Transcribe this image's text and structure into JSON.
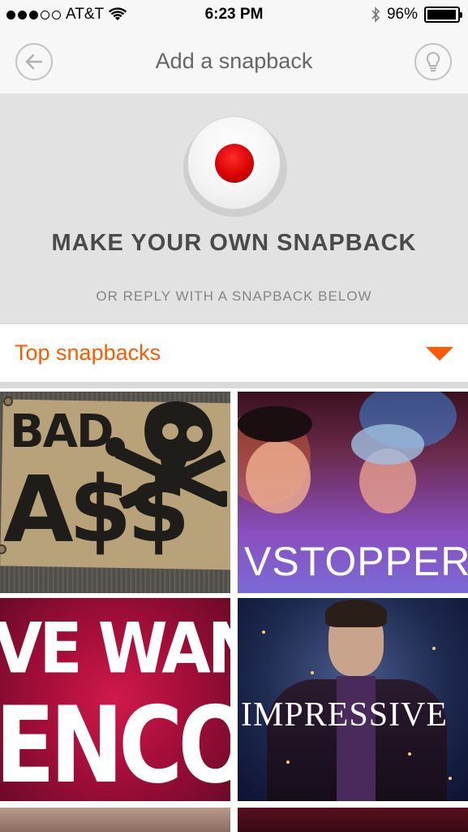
{
  "status_bar": {
    "carrier": "AT&T",
    "time": "6:23 PM",
    "battery": "96%",
    "battery_level": 0.96,
    "signal_bars": 3,
    "signal_total": 5,
    "icons": [
      "wifi-icon",
      "bluetooth-icon",
      "battery-icon"
    ]
  },
  "nav": {
    "title": "Add a snapback",
    "back_icon": "back-arrow-icon",
    "tip_icon": "lightbulb-icon"
  },
  "record": {
    "title": "MAKE YOUR OWN SNAPBACK",
    "subtitle": "OR REPLY WITH A SNAPBACK BELOW",
    "record_color": "#d40000"
  },
  "section": {
    "title": "Top snapbacks",
    "accent_color": "#ff5a00",
    "dropdown_icon": "triangle-down-icon"
  },
  "tiles": [
    {
      "lines": [
        "BAD",
        "A$$"
      ]
    },
    {
      "caption": "VSTOPPER"
    },
    {
      "lines": [
        "VE WANT",
        "ENCOR"
      ]
    },
    {
      "caption": "IMPRESSIVE"
    }
  ]
}
